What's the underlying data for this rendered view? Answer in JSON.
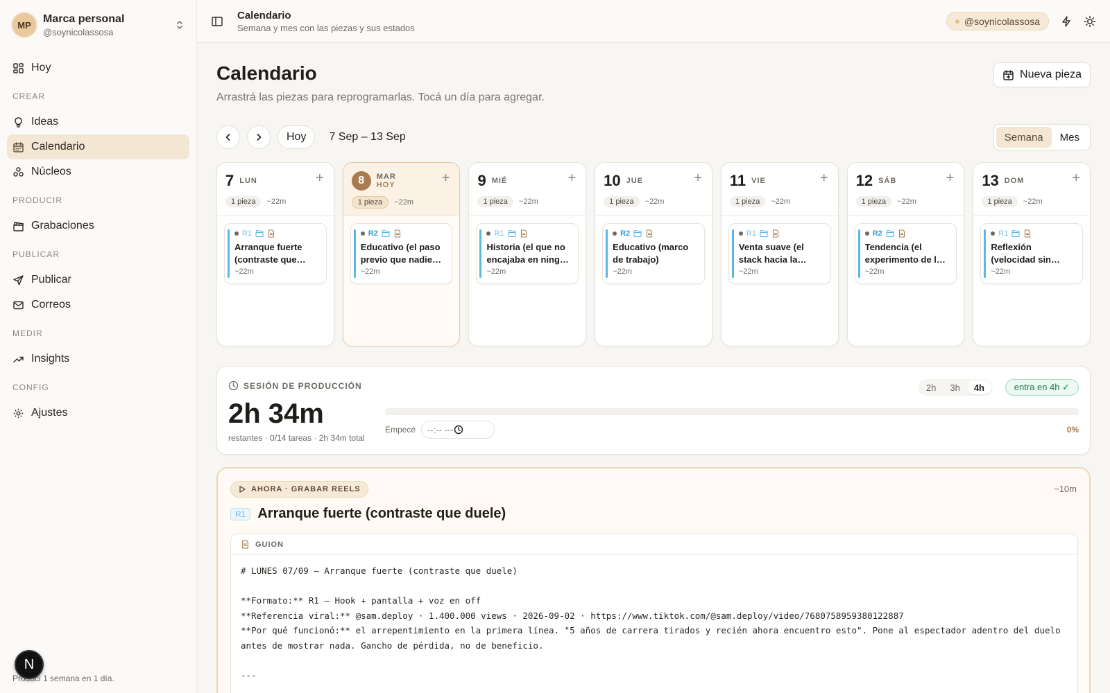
{
  "sidebar": {
    "brand": {
      "initials": "MP",
      "name": "Marca personal",
      "handle": "@soynicolassosa"
    },
    "hoy": "Hoy",
    "sections": {
      "crear": "CREAR",
      "producir": "PRODUCIR",
      "publicar": "PUBLICAR",
      "medir": "MEDIR",
      "config": "CONFIG"
    },
    "items": {
      "ideas": "Ideas",
      "calendario": "Calendario",
      "nucleos": "Núcleos",
      "grabaciones": "Grabaciones",
      "publicar": "Publicar",
      "correos": "Correos",
      "insights": "Insights",
      "ajustes": "Ajustes"
    },
    "active": "calendario",
    "footer": "Produci 1 semana en 1 día.",
    "next_badge": "N"
  },
  "topbar": {
    "title": "Calendario",
    "subtitle": "Semana y mes con las piezas y sus estados",
    "handle": "@soynicolassosa"
  },
  "page": {
    "title": "Calendario",
    "subtitle": "Arrastrá las piezas para reprogramarlas. Tocá un día para agregar.",
    "new_button": "Nueva pieza"
  },
  "toolbar": {
    "today": "Hoy",
    "range": "7 Sep – 13 Sep",
    "views": [
      "Semana",
      "Mes"
    ],
    "active_view": "Semana"
  },
  "days": [
    {
      "num": "7",
      "dow": "LUN",
      "today": false,
      "count": "1 pieza",
      "dur": "~22m",
      "piece": {
        "tag": "R1",
        "title": "Arranque fuerte (contraste que duele)",
        "dur": "~22m"
      }
    },
    {
      "num": "8",
      "dow": "MAR",
      "today_label": "HOY",
      "today": true,
      "count": "1 pieza",
      "dur": "~22m",
      "piece": {
        "tag": "R2",
        "title": "Educativo (el paso previo que nadie explica)",
        "dur": "~22m"
      }
    },
    {
      "num": "9",
      "dow": "MIÉ",
      "today": false,
      "count": "1 pieza",
      "dur": "~22m",
      "piece": {
        "tag": "R1",
        "title": "Historia (el que no encajaba en ningún lado)",
        "dur": "~22m"
      }
    },
    {
      "num": "10",
      "dow": "JUE",
      "today": false,
      "count": "1 pieza",
      "dur": "~22m",
      "piece": {
        "tag": "R2",
        "title": "Educativo (marco de trabajo)",
        "dur": "~22m"
      }
    },
    {
      "num": "11",
      "dow": "VIE",
      "today": false,
      "count": "1 pieza",
      "dur": "~22m",
      "piece": {
        "tag": "R1",
        "title": "Venta suave (el stack hacia la meta)",
        "dur": "~22m"
      }
    },
    {
      "num": "12",
      "dow": "SÁB",
      "today": false,
      "count": "1 pieza",
      "dur": "~22m",
      "piece": {
        "tag": "R2",
        "title": "Tendencia (el experimento de la semana)",
        "dur": "~22m"
      }
    },
    {
      "num": "13",
      "dow": "DOM",
      "today": false,
      "count": "1 pieza",
      "dur": "~22m",
      "piece": {
        "tag": "R1",
        "title": "Reflexión (velocidad sin dirección)",
        "dur": "~22m"
      }
    }
  ],
  "session": {
    "label": "SESIÓN DE PRODUCCIÓN",
    "remaining": "2h 34m",
    "meta": "restantes · 0/14 tareas · 2h 34m total",
    "hour_options": [
      "2h",
      "3h",
      "4h"
    ],
    "active_hours": "4h",
    "fit": "entra en 4h ✓",
    "start_label": "Empecé",
    "start_placeholder": "--:-- ---",
    "progress": 0,
    "progress_label": "0%"
  },
  "now": {
    "badge": "AHORA · GRABAR REELS",
    "duration": "~10m",
    "tag": "R1",
    "title": "Arranque fuerte (contraste que duele)",
    "script_label": "GUION",
    "script": "# LUNES 07/09 — Arranque fuerte (contraste que duele)\n\n**Formato:** R1 — Hook + pantalla + voz en off\n**Referencia viral:** @sam.deploy · 1.400.000 views · 2026-09-02 · https://www.tiktok.com/@sam.deploy/video/7680758959380122887\n**Por qué funcionó:** el arrepentimiento en la primera línea. \"5 años de carrera tirados y recién ahora encuentro esto\". Pone al espectador adentro del duelo antes de mostrar nada. Gancho de pérdida, no de beneficio.\n\n---"
  },
  "colors": {
    "accent": "#a97c50",
    "active_bg": "#f3e7d3",
    "r_stripe": "#5bb8e4",
    "success": "#1c7a52"
  }
}
